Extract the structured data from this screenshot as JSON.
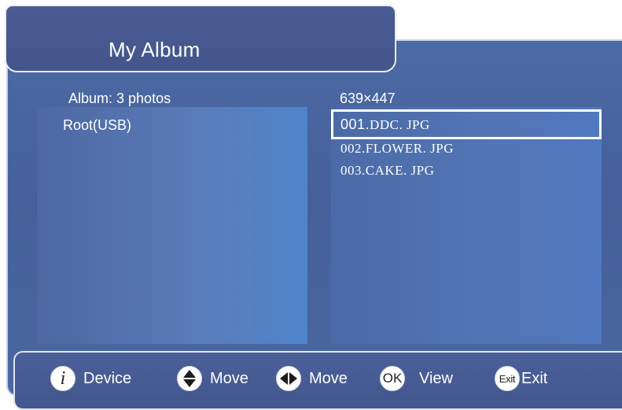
{
  "header": {
    "title": "My Album"
  },
  "album": {
    "count_text": "Album:  3 photos",
    "source": "Root(USB)"
  },
  "preview": {
    "resolution": "639×447"
  },
  "files": [
    {
      "number": "001.",
      "name": "DDC. JPG",
      "selected": true
    },
    {
      "number": "002.",
      "name": "FLOWER. JPG",
      "selected": false
    },
    {
      "number": "003.",
      "name": "CAKE. JPG",
      "selected": false
    }
  ],
  "help_bar": {
    "items": [
      {
        "icon": "info-icon",
        "icon_text": "i",
        "label": "Device"
      },
      {
        "icon": "up-down-arrow-icon",
        "icon_text": "",
        "label": "Move"
      },
      {
        "icon": "left-right-arrow-icon",
        "icon_text": "",
        "label": "Move"
      },
      {
        "icon": "ok-icon",
        "icon_text": "OK",
        "label": "View"
      },
      {
        "icon": "exit-icon",
        "icon_text": "Exit",
        "label": "Exit"
      }
    ]
  }
}
